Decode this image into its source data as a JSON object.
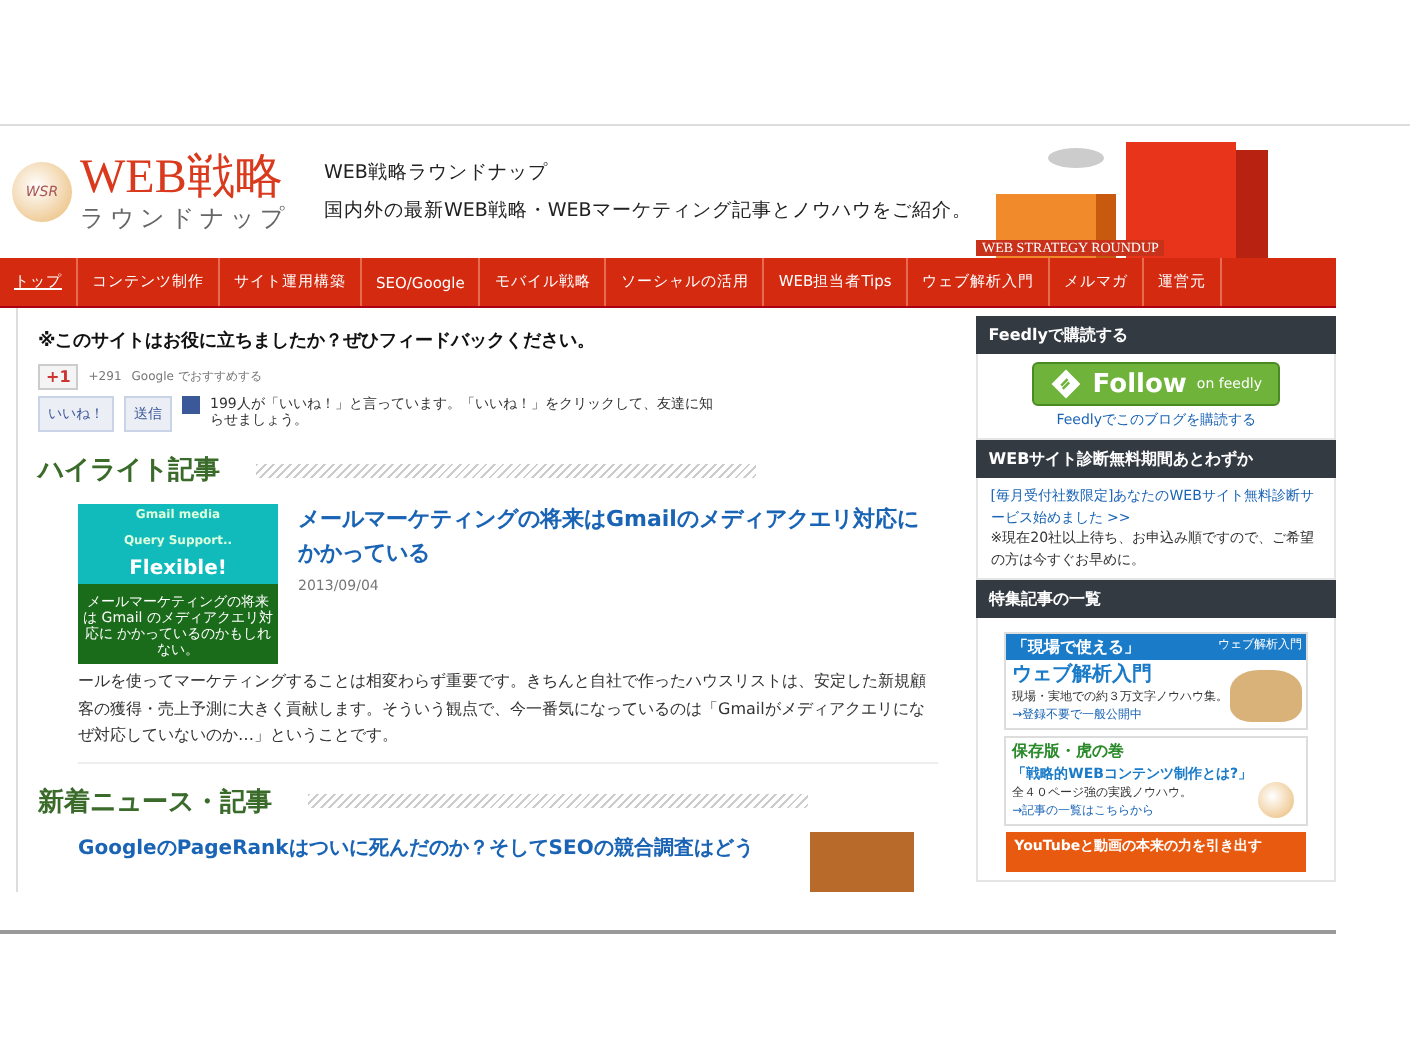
{
  "header": {
    "logo_title": "WEB戦略",
    "logo_subtitle": "ラウンドナップ",
    "logo_badge": "WSR",
    "site_name": "WEB戦略ラウンドナップ",
    "tagline": "国内外の最新WEB戦略・WEBマーケティング記事とノウハウをご紹介。",
    "banner_text": "WEB STRATEGY ROUNDUP"
  },
  "nav": [
    {
      "label": "トップ",
      "selected": true
    },
    {
      "label": "コンテンツ制作",
      "selected": false
    },
    {
      "label": "サイト運用構築",
      "selected": false
    },
    {
      "label": "SEO/Google",
      "selected": false
    },
    {
      "label": "モバイル戦略",
      "selected": false
    },
    {
      "label": "ソーシャルの活用",
      "selected": false
    },
    {
      "label": "WEB担当者Tips",
      "selected": false
    },
    {
      "label": "ウェブ解析入門",
      "selected": false
    },
    {
      "label": "メルマガ",
      "selected": false
    },
    {
      "label": "運営元",
      "selected": false
    }
  ],
  "feedback": {
    "heading": "※このサイトはお役に立ちましたか？ぜひフィードバックください。",
    "gplus_label": "+1",
    "gplus_count": "+291",
    "gplus_text": "Google でおすすめする",
    "like_button": "いいね！",
    "send_button": "送信",
    "fb_text": "199人が「いいね！」と言っています。「いいね！」をクリックして、友達に知らせましょう。"
  },
  "highlight": {
    "heading": "ハイライト記事",
    "article": {
      "thumb_lines": [
        "Gmail media",
        "Query Support..",
        "Flexible!"
      ],
      "thumb_caption": "メールマーケティングの将来は Gmail のメディアクエリ対応に かかっているのかもしれない。",
      "title": "メールマーケティングの将来はGmailのメディアクエリ対応にかかっている",
      "date": "2013/09/04",
      "excerpt": "ールを使ってマーケティングすることは相変わらず重要です。きちんと自社で作ったハウスリストは、安定した新規顧客の獲得・売上予測に大きく貢献します。そういう観点で、今一番気になっているのは「Gmailがメディアクエリになぜ対応していないのか…」ということです。"
    }
  },
  "news": {
    "heading": "新着ニュース・記事",
    "articles": [
      {
        "title": "GoogleのPageRankはついに死んだのか？そしてSEOの競合調査はどう"
      }
    ]
  },
  "sidebar": [
    {
      "kind": "feedly",
      "title": "Feedlyで購読する",
      "button_main": "Follow",
      "button_sub": "on feedly",
      "link": "Feedlyでこのブログを購読する"
    },
    {
      "kind": "notice",
      "title": "WEBサイト診断無料期間あとわずか",
      "link": "[毎月受付社数限定]あなたのWEBサイト無料診断サービス始めました >>",
      "note": "※現在20社以上待ち、お申込み順ですので、ご希望の方は今すぐお早めに。"
    },
    {
      "kind": "banners",
      "title": "特集記事の一覧",
      "banners": [
        {
          "kind": "analytics",
          "lines": [
            "「現場で使える」",
            "ウェブ解析入門",
            "現場・実地での約３万文字ノウハウ集。",
            "→登録不要で一般公開中"
          ],
          "tag": "ウェブ解析入門"
        },
        {
          "kind": "strategy",
          "lines": [
            "保存版・虎の巻",
            "「戦略的WEBコンテンツ制作とは?」",
            "全４０ページ強の実践ノウハウ。",
            "→記事の一覧はこちらから"
          ]
        },
        {
          "kind": "video",
          "lines": [
            "YouTubeと動画の本来の力を引き出す"
          ]
        }
      ]
    }
  ]
}
